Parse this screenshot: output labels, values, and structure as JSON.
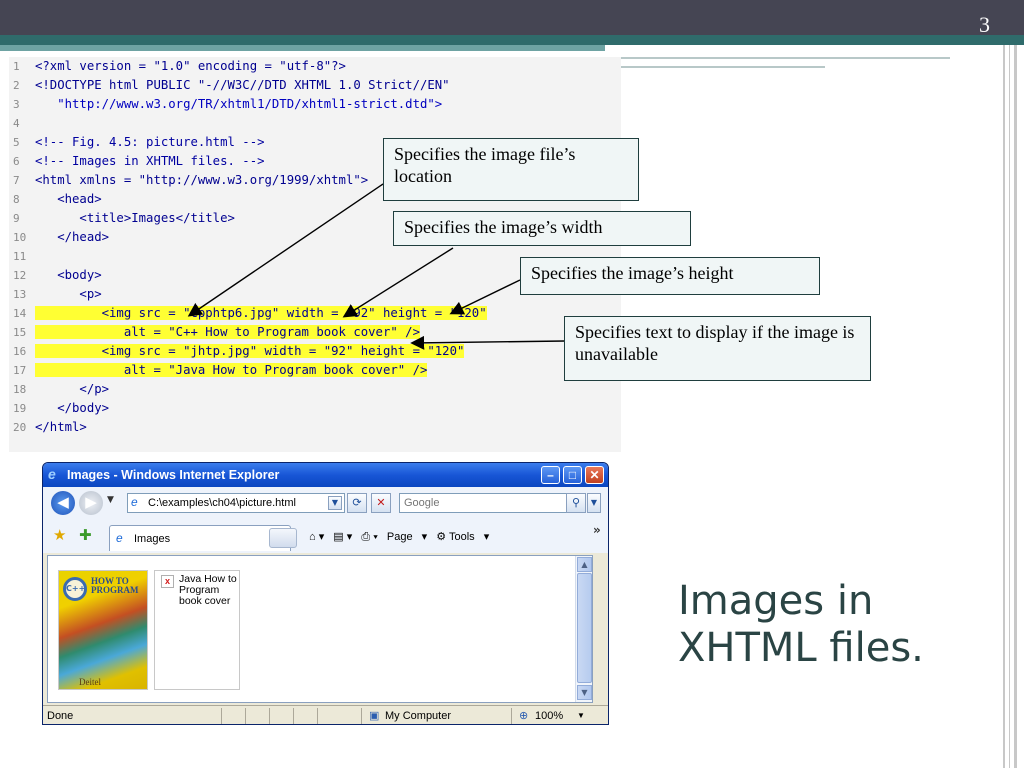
{
  "slide": {
    "page_number": "3",
    "title_line1": "Images in",
    "title_line2": "XHTML files."
  },
  "code": {
    "lines": [
      {
        "n": "1",
        "text": "<?xml version = \"1.0\" encoding = \"utf-8\"?>"
      },
      {
        "n": "2",
        "text": "<!DOCTYPE html PUBLIC \"-//W3C//DTD XHTML 1.0 Strict//EN\""
      },
      {
        "n": "3",
        "text": "   \"http://www.w3.org/TR/xhtml1/DTD/xhtml1-strict.dtd\">"
      },
      {
        "n": "4",
        "text": ""
      },
      {
        "n": "5",
        "text": "<!-- Fig. 4.5: picture.html -->"
      },
      {
        "n": "6",
        "text": "<!-- Images in XHTML files. -->"
      },
      {
        "n": "7",
        "text": "<html xmlns = \"http://www.w3.org/1999/xhtml\">"
      },
      {
        "n": "8",
        "text": "   <head>"
      },
      {
        "n": "9",
        "text": "      <title>Images</title>"
      },
      {
        "n": "10",
        "text": "   </head>"
      },
      {
        "n": "11",
        "text": ""
      },
      {
        "n": "12",
        "text": "   <body>"
      },
      {
        "n": "13",
        "text": "      <p>"
      },
      {
        "n": "14",
        "text": "         <img src = \"cpphtp6.jpg\" width = \"92\" height = \"120\""
      },
      {
        "n": "15",
        "text": "            alt = \"C++ How to Program book cover\" />"
      },
      {
        "n": "16",
        "text": "         <img src = \"jhtp.jpg\" width = \"92\" height = \"120\""
      },
      {
        "n": "17",
        "text": "            alt = \"Java How to Program book cover\" />"
      },
      {
        "n": "18",
        "text": "      </p>"
      },
      {
        "n": "19",
        "text": "   </body>"
      },
      {
        "n": "20",
        "text": "</html>"
      }
    ]
  },
  "callouts": {
    "location": "Specifies the image file’s location",
    "width": "Specifies the image’s width",
    "height": "Specifies the image’s height",
    "alt": "Specifies text to display if the image is unavailable"
  },
  "browser": {
    "window_title": "Images - Windows Internet Explorer",
    "address": "C:\\examples\\ch04\\picture.html",
    "search_placeholder": "Google",
    "tab_label": "Images",
    "page_menu": "Page",
    "tools_menu": "Tools",
    "book1_title": "HOW TO PROGRAM",
    "book1_badge": "C++",
    "book1_author": "Deitel",
    "broken_alt_text": "Java How to Program book cover",
    "status_text": "Done",
    "zone_text": "My Computer",
    "zoom_text": "100%"
  },
  "colors": {
    "top_bar": "#454553",
    "teal": "#2f6b6b",
    "highlight": "#ffff33",
    "title_text": "#2a4444"
  }
}
